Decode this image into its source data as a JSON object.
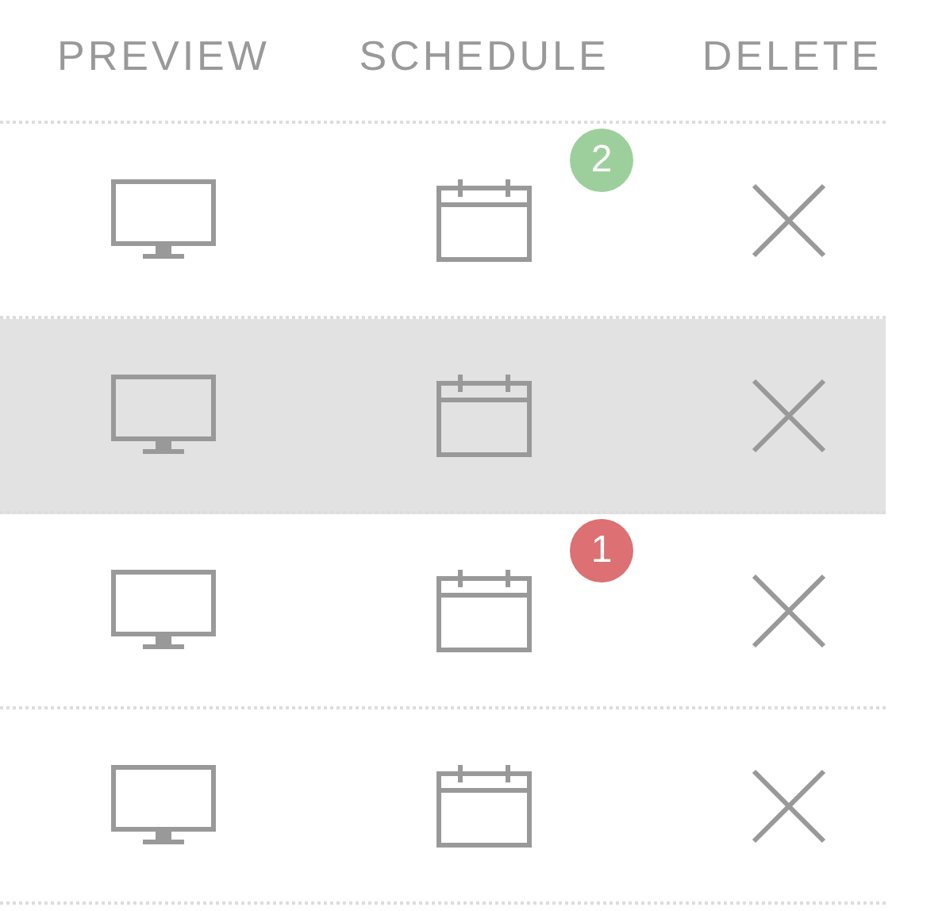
{
  "columns": [
    {
      "label": "PREVIEW"
    },
    {
      "label": "SCHEDULE"
    },
    {
      "label": "DELETE"
    }
  ],
  "rows": [
    {
      "selected": false,
      "badge": {
        "text": "2",
        "color": "#9dcf9c"
      }
    },
    {
      "selected": true
    },
    {
      "selected": false,
      "badge": {
        "text": "1",
        "color": "#dc7072"
      }
    },
    {
      "selected": false
    }
  ]
}
